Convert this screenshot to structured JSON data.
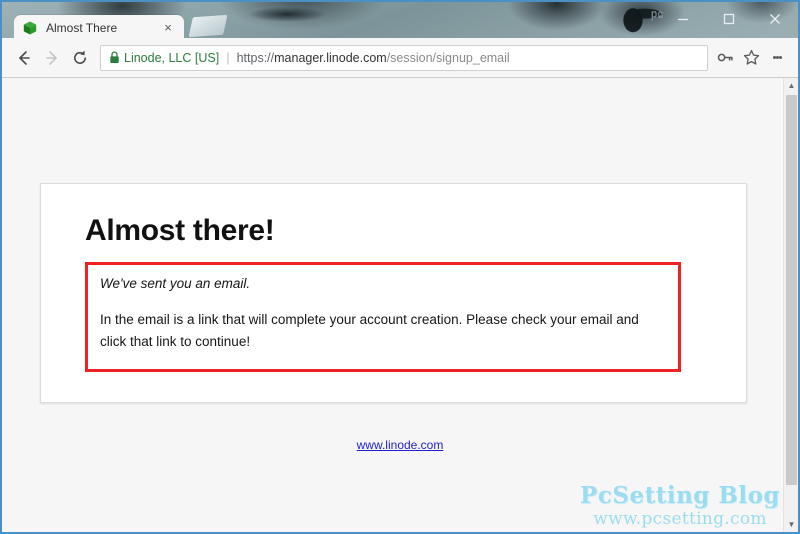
{
  "browser": {
    "tab": {
      "title": "Almost There",
      "favicon": "linode-cube-icon",
      "close_label": "×"
    },
    "window_controls": {
      "watermark_label": "pc",
      "minimize": "—",
      "maximize": "□",
      "close": "✕"
    },
    "toolbar": {
      "back": "←",
      "forward": "→",
      "reload": "⟳",
      "site_identity": "Linode, LLC [US]",
      "separator": "|",
      "url_scheme": "https://",
      "url_origin": "manager.linode.com",
      "url_path": "/session/signup_email",
      "url_full": "https://manager.linode.com/session/signup_email",
      "key_icon": "key-icon",
      "star_icon": "star-icon",
      "menu_icon": "three-dots-menu-icon"
    }
  },
  "page": {
    "heading": "Almost there!",
    "alert": {
      "lead": "We've sent you an email.",
      "body": "In the email is a link that will complete your account creation. Please check your email and click that link to continue!",
      "border_color": "#ee2222"
    },
    "footer_link": {
      "text": "www.linode.com",
      "color": "#2222cc"
    }
  },
  "watermark": {
    "title": "PcSetting Blog",
    "subtitle": "www.pcsetting.com",
    "color": "#9bdcef"
  },
  "scrollbar": {
    "up_arrow": "▲",
    "down_arrow": "▼"
  },
  "colors": {
    "window_border": "#4a90c4",
    "page_background": "#f6f6f6",
    "card_background": "#ffffff",
    "secure_green": "#2d7c3f"
  }
}
